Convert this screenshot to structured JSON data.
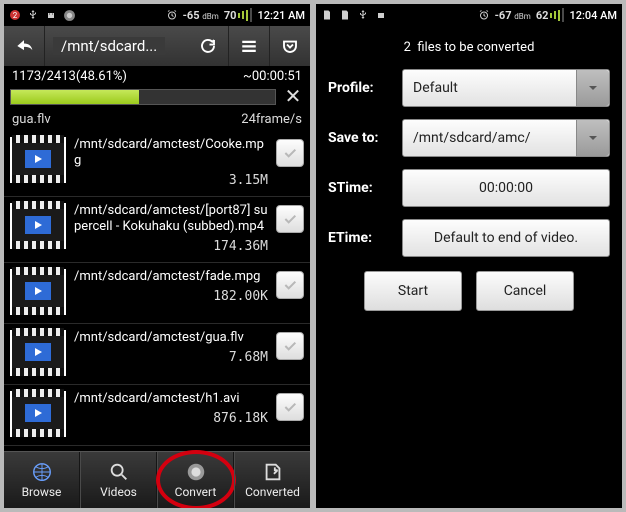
{
  "left": {
    "status": {
      "signal": "-65",
      "signal_unit": "dBm",
      "battery": "70",
      "time": "12:21 AM"
    },
    "actionbar": {
      "path": "/mnt/sdcard..."
    },
    "progress": {
      "count": "1173/2413(48.61%)",
      "eta": "~00:00:51",
      "percent": 48.61,
      "file": "gua.flv",
      "rate": "24frame/s"
    },
    "files": [
      {
        "path": "/mnt/sdcard/amctest/Cooke.mpg",
        "size": "3.15M"
      },
      {
        "path": "/mnt/sdcard/amctest/[port87] supercell - Kokuhaku (subbed).mp4",
        "size": "174.36M"
      },
      {
        "path": "/mnt/sdcard/amctest/fade.mpg",
        "size": "182.00K"
      },
      {
        "path": "/mnt/sdcard/amctest/gua.flv",
        "size": "7.68M"
      },
      {
        "path": "/mnt/sdcard/amctest/h1.avi",
        "size": "876.18K"
      }
    ],
    "tabs": {
      "browse": "Browse",
      "videos": "Videos",
      "convert": "Convert",
      "converted": "Converted"
    }
  },
  "right": {
    "status": {
      "signal": "-67",
      "signal_unit": "dBm",
      "battery": "62",
      "time": "12:04 AM"
    },
    "header_count": "2",
    "header_text": "files to be converted",
    "labels": {
      "profile": "Profile:",
      "saveto": "Save to:",
      "stime": "STime:",
      "etime": "ETime:"
    },
    "values": {
      "profile": "Default",
      "saveto": "/mnt/sdcard/amc/",
      "stime": "00:00:00",
      "etime": "Default to end of video."
    },
    "buttons": {
      "start": "Start",
      "cancel": "Cancel"
    }
  }
}
